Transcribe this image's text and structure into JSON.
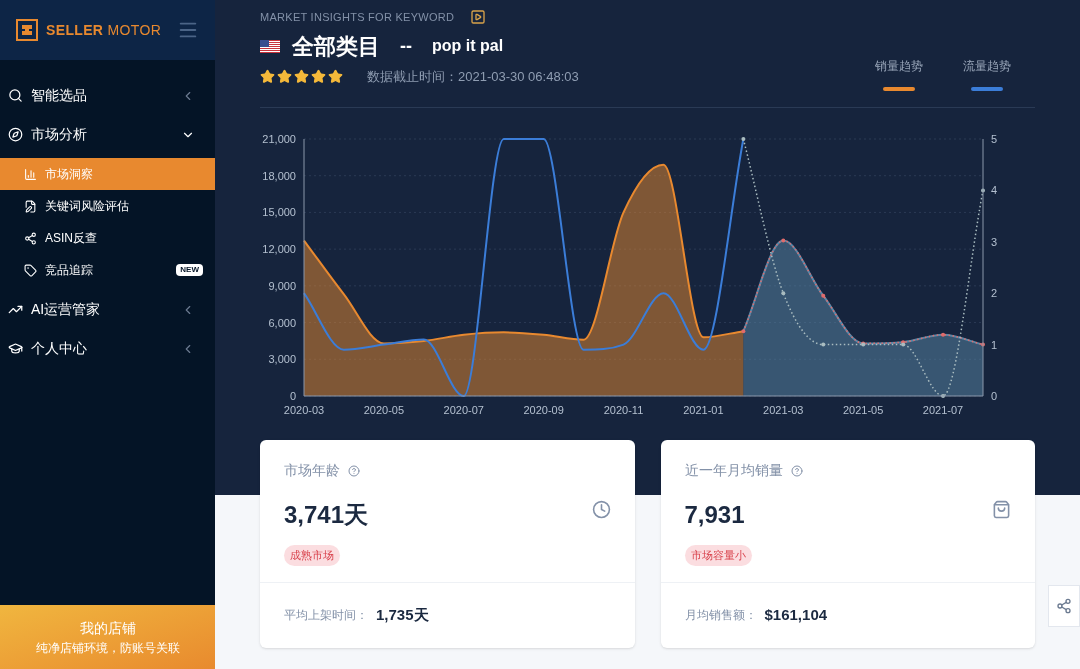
{
  "sidebar": {
    "brand": {
      "word_1": "SELLER",
      "word_2": "MOTOR"
    },
    "items": [
      {
        "kind": "group",
        "label": "智能选品",
        "expanded": false
      },
      {
        "kind": "group",
        "label": "市场分析",
        "expanded": true,
        "children": [
          {
            "label": "市场洞察",
            "selected": true
          },
          {
            "label": "关键词风险评估",
            "selected": false
          },
          {
            "label": "ASIN反查",
            "selected": false
          },
          {
            "label": "竞品追踪",
            "selected": false,
            "badge": "NEW"
          }
        ]
      },
      {
        "kind": "group",
        "label": "AI运营管家",
        "expanded": false
      },
      {
        "kind": "group",
        "label": "个人中心",
        "expanded": false
      }
    ],
    "promo": {
      "title": "我的店铺",
      "subtitle": "纯净店铺环境，防账号关联"
    }
  },
  "header": {
    "eyebrow": "MARKET INSIGHTS FOR KEYWORD",
    "category": "全部类目",
    "separator": "--",
    "keyword": "pop it pal",
    "stars": 5,
    "updated": "数据截止时间：2021-03-30 06:48:03"
  },
  "chart_data": {
    "type": "area",
    "categories": [
      "2020-03",
      null,
      "2020-05",
      null,
      "2020-07",
      null,
      "2020-09",
      null,
      "2020-11",
      null,
      "2021-01",
      null,
      "2021-03",
      null,
      "2021-05",
      null,
      "2021-07",
      null
    ],
    "ylim": [
      0,
      21000
    ],
    "yticks": [
      {
        "value": 0,
        "label": "0"
      },
      {
        "value": 3000,
        "label": "3,000"
      },
      {
        "value": 6000,
        "label": "6,000"
      },
      {
        "value": 9000,
        "label": "9,000"
      },
      {
        "value": 12000,
        "label": "12,000"
      },
      {
        "value": 15000,
        "label": "15,000"
      },
      {
        "value": 18000,
        "label": "18,000"
      },
      {
        "value": 21000,
        "label": "21,000"
      }
    ],
    "y2lim": [
      0,
      5
    ],
    "y2ticks": [
      0,
      1,
      2,
      3,
      4,
      5
    ],
    "grid": true,
    "series": [
      {
        "name": "销量趋势",
        "color": "#e8892f",
        "type": "area",
        "values": [
          12700,
          8300,
          4300,
          4500,
          5000,
          5200,
          5000,
          4600,
          15000,
          18900,
          4800,
          5300,
          null,
          null,
          null,
          null,
          null,
          null
        ]
      },
      {
        "name": "流量趋势",
        "color": "#3b7dd8",
        "type": "line",
        "axis": "y2",
        "values": [
          2,
          0.9,
          1,
          1.1,
          0,
          5,
          5,
          0.9,
          1,
          2,
          0.9,
          5,
          null,
          null,
          null,
          null,
          null,
          null
        ]
      },
      {
        "color": "#5a88a8",
        "type": "area",
        "values": [
          null,
          null,
          null,
          null,
          null,
          null,
          null,
          null,
          null,
          null,
          null,
          5300,
          12700,
          8200,
          4300,
          4400,
          5000,
          4200
        ]
      },
      {
        "color": "#e06b6b",
        "type": "line",
        "line_style": "dotted",
        "values": [
          null,
          null,
          null,
          null,
          null,
          null,
          null,
          null,
          null,
          null,
          null,
          5300,
          12700,
          8200,
          4300,
          4400,
          5000,
          4200
        ]
      },
      {
        "color": "#a9bcc0",
        "type": "line",
        "line_style": "dotted",
        "axis": "y2",
        "values": [
          null,
          null,
          null,
          null,
          null,
          null,
          null,
          null,
          null,
          null,
          null,
          5,
          2,
          1,
          1,
          1,
          0,
          4
        ]
      }
    ]
  },
  "cards": [
    {
      "title": "市场年龄",
      "value": "3,741天",
      "tag": "成熟市场",
      "footer_label": "平均上架时间：",
      "footer_value": "1,735天"
    },
    {
      "title": "近一年月均销量",
      "value": "7,931",
      "tag": "市场容量小",
      "footer_label": "月均销售额：",
      "footer_value": "$161,104"
    }
  ]
}
